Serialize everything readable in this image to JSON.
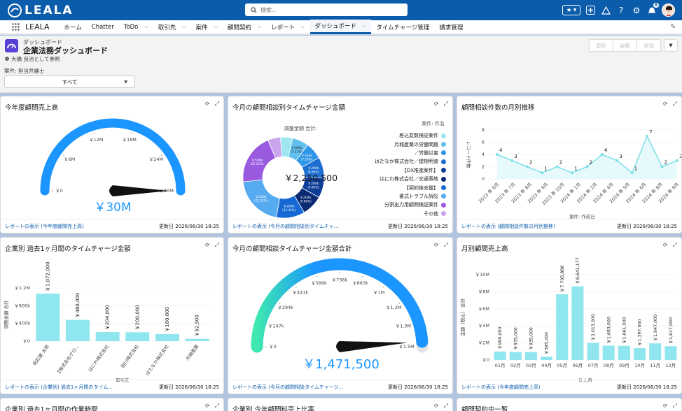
{
  "topbar": {
    "logo_text": "LEALA",
    "search_placeholder": "検索...",
    "notification_count": "8"
  },
  "nav": {
    "app_name": "LEALA",
    "items": [
      {
        "label": "ホーム",
        "dropdown": false
      },
      {
        "label": "Chatter",
        "dropdown": false
      },
      {
        "label": "ToDo",
        "dropdown": true
      },
      {
        "label": "取引先",
        "dropdown": true
      },
      {
        "label": "案件",
        "dropdown": true
      },
      {
        "label": "顧問契約",
        "dropdown": true
      },
      {
        "label": "レポート",
        "dropdown": true
      },
      {
        "label": "ダッシュボード",
        "dropdown": true,
        "active": true
      },
      {
        "label": "タイムチャージ管理",
        "dropdown": false
      },
      {
        "label": "請求管理",
        "dropdown": false
      }
    ]
  },
  "header": {
    "kind": "ダッシュボード",
    "title": "企業法務ダッシュボード",
    "view_as": "大橋 良治として参照",
    "filter_label": "案件: 担当弁護士",
    "filter_value": "すべて",
    "buttons": [
      "更新",
      "編集",
      "登録"
    ]
  },
  "colors": {
    "brand": "#0b5cab",
    "gauge_blue": "#1b96ff",
    "bar_teal": "#90e6ee",
    "line_teal": "#7ee0e8"
  },
  "cards": {
    "c1": {
      "title": "今年度顧問売上高",
      "value": "￥30M",
      "footer_link": "レポートの表示 (今年度顧問売上高)",
      "updated": "更新日 2026/06/30 18:25",
      "ticks": [
        "￥0",
        "￥6M",
        "￥12M",
        "￥18M",
        "￥24M",
        "￥30M"
      ],
      "gauge_fraction": 1.0
    },
    "c2": {
      "title": "今月の顧問相談別タイムチャージ金額",
      "center_label": "調整金額 合計:",
      "center_value": "￥2,250,500",
      "legend_title": "案件: 件名",
      "footer_link": "レポートの表示 (今月の顧問相談別タイムチャ...",
      "updated": "更新日 2026/06/30 18:25",
      "slices": [
        {
          "name": "差込変数検証案件",
          "color": "#9ee7f0",
          "value": 120000,
          "label": ""
        },
        {
          "name": "月城産業の労働問題",
          "color": "#62c0ee",
          "value": 160000,
          "label": "￥160k (7.11%)"
        },
        {
          "name": "／労働災害",
          "color": "#2e96e6",
          "value": 164000,
          "label": "￥164k (7.29%)"
        },
        {
          "name": "はたなか株式会社／建物明渡",
          "color": "#1c6fd0",
          "value": 200000,
          "label": "￥200k (8.89%)"
        },
        {
          "name": "【DX推進案件】",
          "color": "#0c3d97",
          "value": 200000,
          "label": "￥200k (8.89%)"
        },
        {
          "name": "はにわ株式会社／交通事故",
          "color": "#0a2a73",
          "value": 204000,
          "label": "￥204k (9.06%)"
        },
        {
          "name": "【契約後支援】",
          "color": "#1669d4",
          "value": 280000,
          "label": "￥280k (12.44%)"
        },
        {
          "name": "書式トラブル訴訟",
          "color": "#55aaf0",
          "value": 500000,
          "label": "￥500k (22.22%)"
        },
        {
          "name": "分割出力用顧問検証案件",
          "color": "#9a5ae0",
          "value": 500000,
          "label": "￥500k (22.22%)"
        },
        {
          "name": "その他",
          "color": "#c9a5ee",
          "value": 122500,
          "label": ""
        }
      ]
    },
    "c3": {
      "title": "顧問相談件数の月別推移",
      "footer_link": "レポートの表示 (顧問相談件数の月別推移)",
      "updated": "更新日 2026/06/30 18:25"
    },
    "c4": {
      "title": "企業別 過去1ヶ月間のタイムチャージ金額",
      "footer_link": "レポートの表示 (企業別) 過去1ヶ月間のタイム...",
      "updated": "更新日 2026/06/30 18:25"
    },
    "c5": {
      "title": "今月の顧問相談タイムチャージ金額合計",
      "value": "￥1,471,500",
      "footer_link": "レポートの表示 (今月の顧問相談タイムチャージ...",
      "updated": "更新日 2026/06/30 18:25",
      "ticks": [
        "￥0",
        "￥147k",
        "￥294k",
        "￥441k",
        "￥589k",
        "￥736k",
        "￥883k",
        "￥1M",
        "￥1.2M",
        "￥1.3M",
        "￥1.5M"
      ],
      "gauge_fraction": 0.981
    },
    "c6": {
      "title": "月別顧問売上高",
      "footer_link": "レポートの表示 (今年度顧問売上高)",
      "updated": "更新日 2026/06/30 18:25"
    },
    "c7": {
      "title": "企業別 過去1ヶ月間の作業時間"
    },
    "c8": {
      "title": "企業別 今年顧問料売上比率"
    },
    "c9": {
      "title": "顧問契約中一覧"
    }
  },
  "chart_data": [
    {
      "type": "line",
      "title": "顧問相談件数の月別推移",
      "xlabel": "案件: 作成日",
      "ylabel": "レコード件数",
      "categories": [
        "2023 年 6月",
        "2023 年 7月",
        "2023 年 8月",
        "2023 年 9月",
        "2023 年 10月",
        "2024 年 1月",
        "2024 年 2月",
        "2024 年 4月",
        "2024 年 5月",
        "2024 年 6月",
        "2024 年 8月",
        "2024 年 9月"
      ],
      "values": [
        4,
        3,
        2,
        1,
        2,
        1,
        2,
        4,
        3,
        1,
        7,
        2,
        3
      ],
      "ylim": [
        0,
        8
      ],
      "yticks": [
        0,
        2,
        4,
        6,
        8
      ]
    },
    {
      "type": "bar",
      "title": "企業別 過去1ヶ月間のタイムチャージ金額",
      "xlabel": "取引先",
      "ylabel": "調整金額 合計",
      "categories": [
        "明石屋 太郎",
        "【株式会社グロ...",
        "はにわ株式会社",
        "田川株式会社",
        "はたなか株式会社",
        "月城産業"
      ],
      "values": [
        1072000,
        480000,
        204000,
        200000,
        160000,
        52500
      ],
      "labels": [
        "￥1,072,000",
        "￥480,000",
        "￥204,000",
        "￥200,000",
        "￥160,000",
        "￥52,500"
      ],
      "yticks": [
        "￥0",
        "￥400k",
        "￥800k",
        "￥1.2M"
      ],
      "ylim": [
        0,
        1200000
      ]
    },
    {
      "type": "bar",
      "title": "月別顧問売上高",
      "xlabel": "計上月",
      "ylabel": "金額（税込） 合計",
      "categories": [
        "01月",
        "02月",
        "03月",
        "04月",
        "05月",
        "06月",
        "07月",
        "08月",
        "09月",
        "10月",
        "11月",
        "12月"
      ],
      "values": [
        990000,
        935000,
        935000,
        385000,
        7705886,
        8641177,
        2013000,
        1683000,
        1661000,
        1397000,
        1947000,
        1617000
      ],
      "labels": [
        "￥990,000",
        "￥935,000",
        "￥935,000",
        "￥385,000",
        "￥7,705,886",
        "￥8,641,177",
        "￥2,013,000",
        "￥1,683,000",
        "￥1,661,000",
        "￥1,397,000",
        "￥1,947,000",
        "￥1,617,000"
      ],
      "yticks": [
        "￥0",
        "￥2M",
        "￥4M",
        "￥6M",
        "￥8M",
        "￥10M"
      ],
      "ylim": [
        0,
        10000000
      ]
    }
  ]
}
